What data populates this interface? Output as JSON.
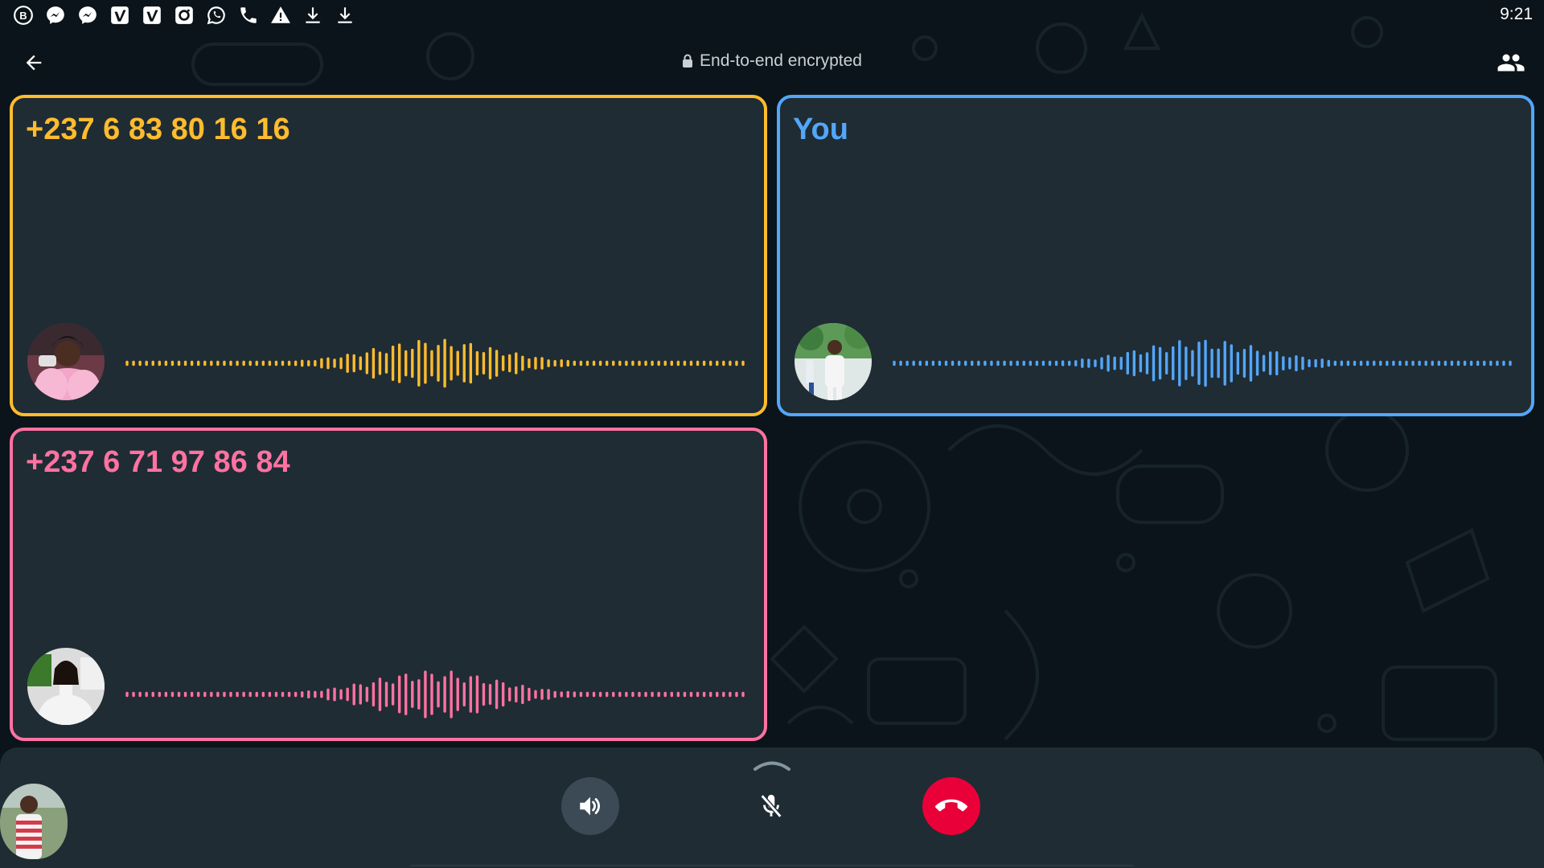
{
  "status_bar": {
    "time": "9:21",
    "icons": [
      "bixby-icon",
      "messenger-icon",
      "messenger-icon",
      "vimeo-icon",
      "vimeo-icon",
      "camera-app-icon",
      "whatsapp-icon",
      "phone-icon",
      "warning-icon",
      "download-icon",
      "download-icon"
    ]
  },
  "header": {
    "encryption_text": "End-to-end encrypted",
    "back_icon": "arrow-left-icon",
    "participants_icon": "people-icon"
  },
  "participants": [
    {
      "name": "+237 6 83 80 16 16",
      "color": "#ffbc2d",
      "avatar": "avatar-woman-pink-coat"
    },
    {
      "name": "You",
      "color": "#53a6f8",
      "avatar": "avatar-man-white-outfit"
    },
    {
      "name": "+237 6 71 97 86 84",
      "color": "#ff72a1",
      "avatar": "avatar-woman-white-top"
    }
  ],
  "controls": {
    "speaker_icon": "speaker-icon",
    "mute_icon": "mic-off-icon",
    "end_call_icon": "call-end-icon",
    "end_call_color": "#ea0038",
    "expand_icon": "chevron-up-icon"
  }
}
